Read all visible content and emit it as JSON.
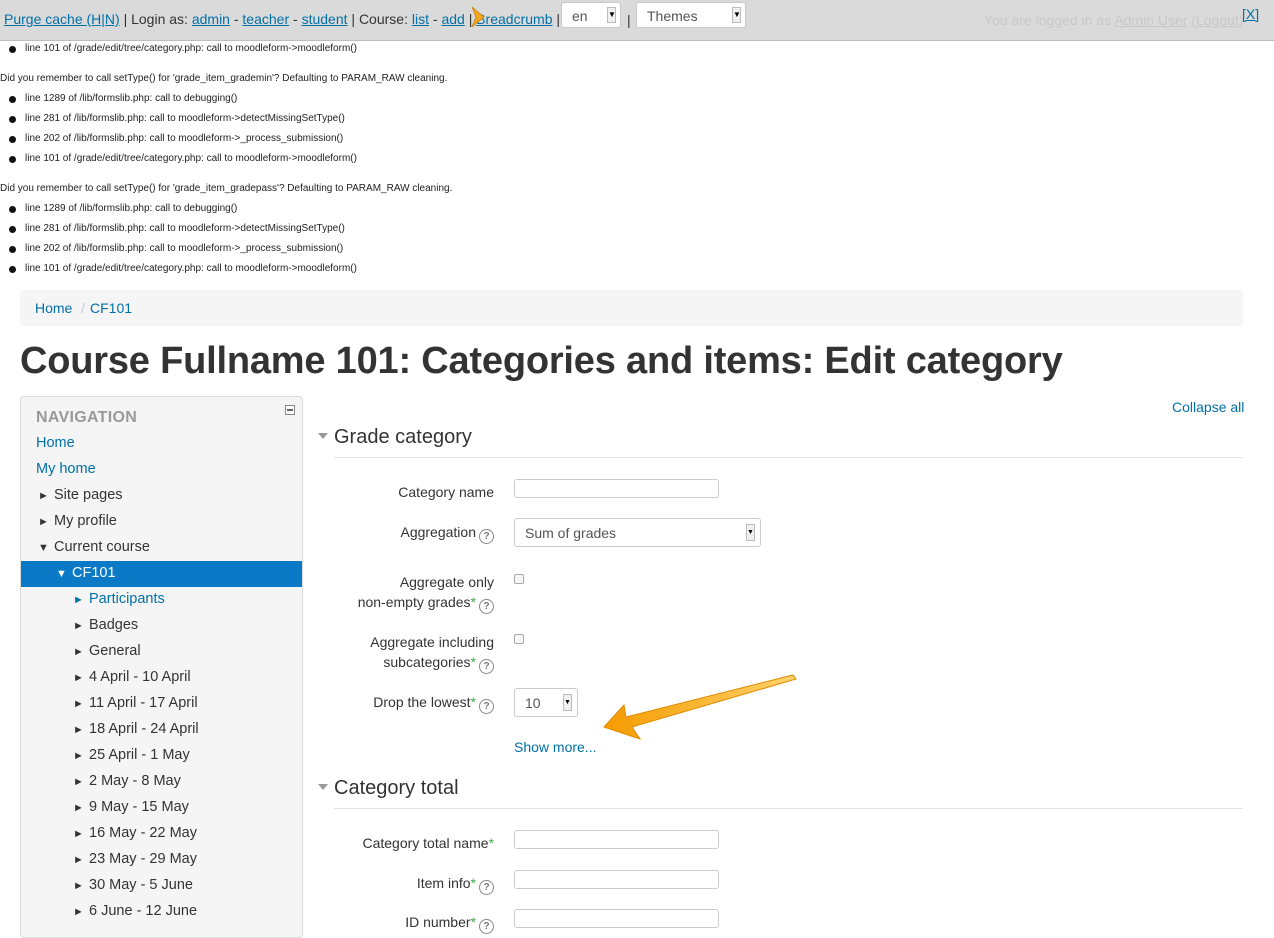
{
  "devbar": {
    "purge_cache": "Purge cache (H|N)",
    "login_as": "Login as:",
    "admin": "admin",
    "teacher": "teacher",
    "student": "student",
    "course": "Course:",
    "list": "list",
    "add": "add",
    "breadcrumb": "Breadcrumb",
    "lang_value": "en",
    "themes_value": "Themes",
    "logged_in_text": "You are logged in as",
    "logged_in_user": "Admin User",
    "logout": "(Logout)",
    "close": "[X]"
  },
  "debug": {
    "top_line": "line 101 of /grade/edit/tree/category.php: call to moodleform->moodleform()",
    "blocks": [
      {
        "message": "Did you remember to call setType() for 'grade_item_grademin'? Defaulting to PARAM_RAW cleaning.",
        "lines": [
          "line 1289 of /lib/formslib.php: call to debugging()",
          "line 281 of /lib/formslib.php: call to moodleform->detectMissingSetType()",
          "line 202 of /lib/formslib.php: call to moodleform->_process_submission()",
          "line 101 of /grade/edit/tree/category.php: call to moodleform->moodleform()"
        ]
      },
      {
        "message": "Did you remember to call setType() for 'grade_item_gradepass'? Defaulting to PARAM_RAW cleaning.",
        "lines": [
          "line 1289 of /lib/formslib.php: call to debugging()",
          "line 281 of /lib/formslib.php: call to moodleform->detectMissingSetType()",
          "line 202 of /lib/formslib.php: call to moodleform->_process_submission()",
          "line 101 of /grade/edit/tree/category.php: call to moodleform->moodleform()"
        ]
      }
    ]
  },
  "breadcrumb": {
    "home": "Home",
    "course": "CF101"
  },
  "page_title": "Course Fullname 101: Categories and items: Edit category",
  "nav": {
    "title": "NAVIGATION",
    "home": "Home",
    "my_home": "My home",
    "site_pages": "Site pages",
    "my_profile": "My profile",
    "current_course": "Current course",
    "cf101": "CF101",
    "participants": "Participants",
    "badges": "Badges",
    "general": "General",
    "weeks": [
      "4 April - 10 April",
      "11 April - 17 April",
      "18 April - 24 April",
      "25 April - 1 May",
      "2 May - 8 May",
      "9 May - 15 May",
      "16 May - 22 May",
      "23 May - 29 May",
      "30 May - 5 June",
      "6 June - 12 June"
    ]
  },
  "form": {
    "collapse_all": "Collapse all",
    "grade_category": "Grade category",
    "category_name": "Category name",
    "aggregation": "Aggregation",
    "aggregation_value": "Sum of grades",
    "aggregate_only_1": "Aggregate only",
    "aggregate_only_2": "non-empty grades",
    "aggregate_incl_1": "Aggregate including",
    "aggregate_incl_2": "subcategories",
    "drop_lowest": "Drop the lowest",
    "drop_lowest_value": "10",
    "show_more": "Show more...",
    "category_total": "Category total",
    "category_total_name": "Category total name",
    "item_info": "Item info",
    "id_number": "ID number"
  },
  "colors": {
    "link": "#0070a8",
    "active_nav": "#0a7ac7",
    "required": "#3cb043",
    "arrow": "#f5a623"
  }
}
